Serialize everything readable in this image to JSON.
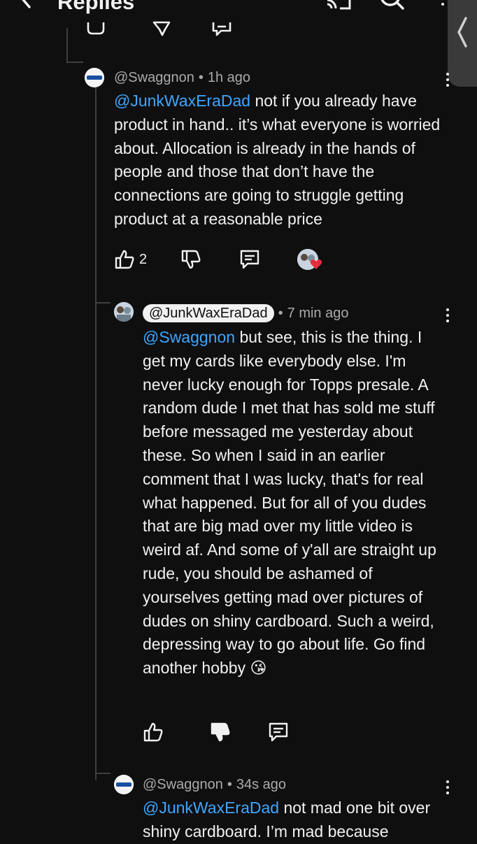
{
  "header": {
    "title": "Replies"
  },
  "comments": [
    {
      "author": "@Swaggnon",
      "time": "1h ago",
      "mention": "@JunkWaxEraDad",
      "text": " not if you already have product in hand.. it’s what everyone is worried about. Allocation is already in the hands of people and those that don’t have the connections are going to struggle getting product at a reasonable price",
      "likes": "2"
    },
    {
      "author": "@JunkWaxEraDad",
      "time": "7 min ago",
      "mention": "@Swaggnon",
      "text": " but see, this is the thing. I get my cards like everybody else. I'm never lucky enough for Topps presale. A random dude I met that has sold me stuff before messaged me yesterday about these. So when I said in an earlier comment that I was lucky, that's for real what happened. But for all of you dudes that are big mad over my little video is weird af. And some of y'all are straight up rude, you should be ashamed of yourselves getting mad over pictures of dudes on shiny cardboard. Such a weird, depressing way to go about life. Go find another hobby 😘"
    },
    {
      "author": "@Swaggnon",
      "time": "34s ago",
      "mention": "@JunkWaxEraDad",
      "text": " not mad one bit over shiny cardboard. I’m mad because"
    }
  ],
  "icons": {
    "back": "back-arrow-icon",
    "cast": "cast-icon",
    "search": "search-icon",
    "menu": "more-vert-icon",
    "like": "thumbs-up-icon",
    "dislike": "thumbs-down-icon",
    "reply": "reply-icon",
    "creator_heart": "heart-icon"
  },
  "colors": {
    "background": "#0f0f0f",
    "mention": "#3ea6ff",
    "heart": "#e62b3c",
    "muted": "#aaaaaa"
  }
}
